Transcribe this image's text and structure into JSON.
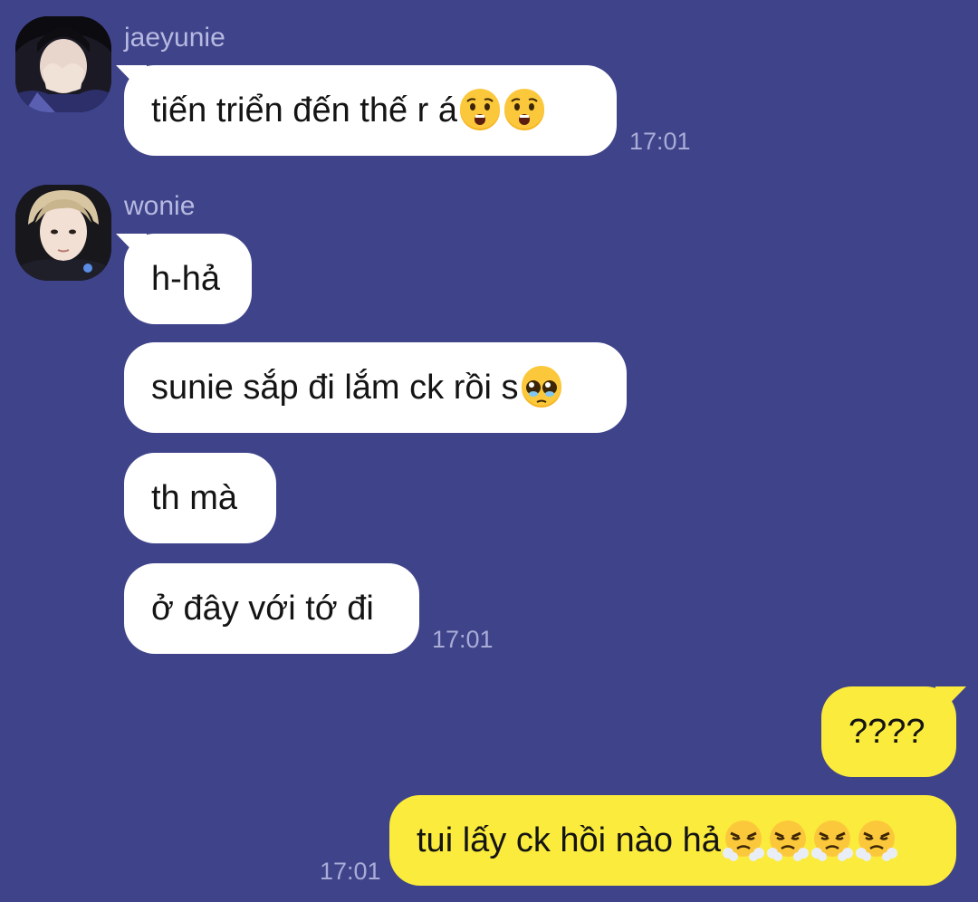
{
  "colors": {
    "background": "#3f438a",
    "incoming_bubble": "#ffffff",
    "outgoing_bubble": "#fbeb3c",
    "sender_name": "#b6b9e0",
    "timestamp": "#a9acd6"
  },
  "messages": {
    "m1": {
      "sender": "jaeyunie",
      "text": "tiến triển đến thế r á",
      "emojis": [
        "hushed-face-icon",
        "hushed-face-icon"
      ],
      "time": "17:01"
    },
    "m2": {
      "sender": "wonie",
      "bubbles": [
        {
          "text": "h-hả"
        },
        {
          "text": "sunie sắp đi lắm ck rồi s",
          "emojis": [
            "pleading-face-icon"
          ]
        },
        {
          "text": "th mà"
        },
        {
          "text": "ở đây với tớ đi"
        }
      ],
      "time": "17:01"
    },
    "m3": {
      "bubbles": [
        {
          "text": "????"
        },
        {
          "text": "tui lấy ck hồi nào hả",
          "emojis": [
            "steam-face-icon",
            "steam-face-icon",
            "steam-face-icon",
            "steam-face-icon"
          ]
        }
      ],
      "time": "17:01"
    }
  }
}
